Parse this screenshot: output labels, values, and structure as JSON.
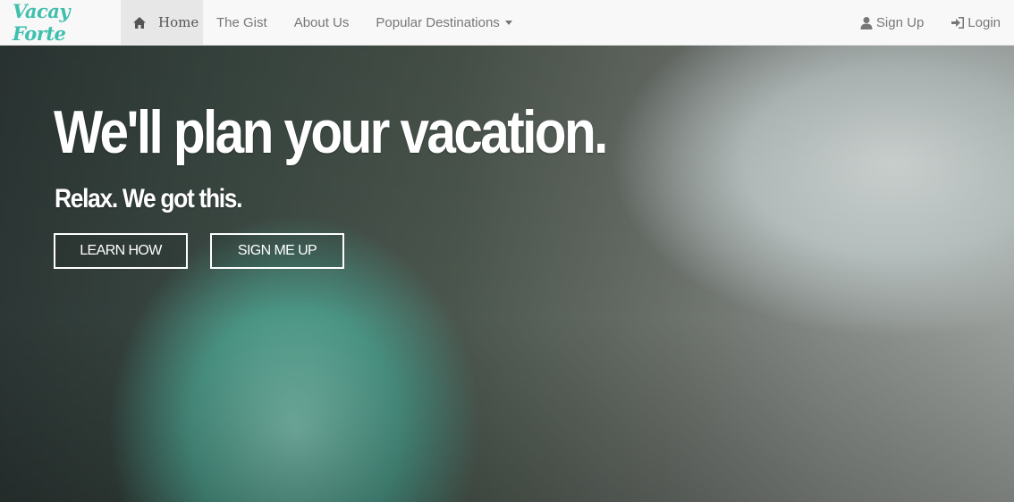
{
  "navbar": {
    "brand": "Vacay Forte",
    "items": [
      {
        "label": "Home",
        "icon": "home-icon",
        "active": true
      },
      {
        "label": "The Gist"
      },
      {
        "label": "About Us"
      },
      {
        "label": "Popular Destinations",
        "dropdown": true
      }
    ],
    "right": [
      {
        "label": "Sign Up",
        "icon": "user-icon"
      },
      {
        "label": "Login",
        "icon": "login-icon"
      }
    ]
  },
  "hero": {
    "title": "We'll plan your vacation.",
    "subtitle": "Relax. We got this.",
    "buttons": {
      "learn": "LEARN HOW",
      "signup": "SIGN ME UP"
    }
  },
  "colors": {
    "brand": "#3fbfae",
    "navbar_bg": "#f8f8f8",
    "active_bg": "#e7e7e7"
  }
}
